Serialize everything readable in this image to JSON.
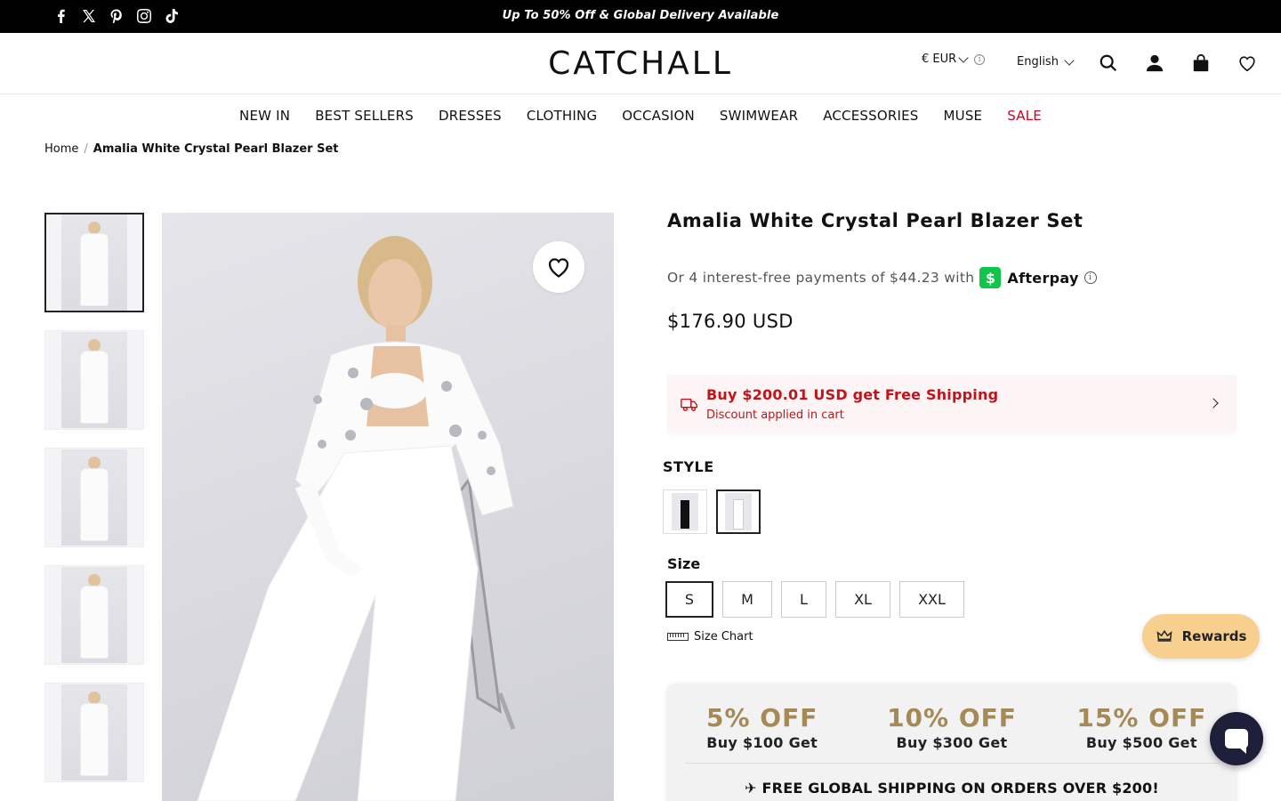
{
  "announcement": {
    "text": "Up To 50% Off & Global Delivery Available",
    "socials": [
      "facebook-icon",
      "x-icon",
      "pinterest-icon",
      "instagram-icon",
      "tiktok-icon"
    ]
  },
  "header": {
    "logo": "CATCHALL",
    "currency": "€ EUR",
    "language": "English",
    "icons": [
      "search-icon",
      "account-icon",
      "bag-icon",
      "wishlist-icon"
    ]
  },
  "nav": {
    "items": [
      "NEW IN",
      "BEST SELLERS",
      "DRESSES",
      "CLOTHING",
      "OCCASION",
      "SWIMWEAR",
      "ACCESSORIES",
      "MUSE",
      "SALE"
    ],
    "sale_color": "#d0021b"
  },
  "breadcrumb": {
    "home": "Home",
    "separator": "/",
    "current": "Amalia White Crystal Pearl Blazer Set"
  },
  "product": {
    "title": "Amalia White Crystal Pearl Blazer Set",
    "afterpay_text": "Or 4 interest-free payments of $44.23 with",
    "afterpay_brand": "Afterpay",
    "afterpay_badge": "$",
    "price": "$176.90 USD",
    "shipping": {
      "headline": "Buy $200.01 USD get Free Shipping",
      "subline": "Discount applied in cart"
    },
    "style_label": "STYLE",
    "size_label": "Size",
    "sizes": [
      "S",
      "M",
      "L",
      "XL",
      "XXL"
    ],
    "selected_size": "S",
    "size_chart": "Size Chart"
  },
  "promo": {
    "tiers": [
      {
        "off": "5% OFF",
        "cond": "Buy $100 Get"
      },
      {
        "off": "10% OFF",
        "cond": "Buy $300 Get"
      },
      {
        "off": "15% OFF",
        "cond": "Buy $500 Get"
      }
    ],
    "free_shipping": "✈ FREE GLOBAL SHIPPING ON ORDERS OVER $200!"
  },
  "rewards": {
    "label": "Rewards"
  },
  "colors": {
    "accent_red": "#c0141a",
    "gold": "#a58a57",
    "rewards_bg": "#f7cf8e",
    "chat_bg": "#1e1f3a",
    "afterpay_green": "#12c44a"
  }
}
